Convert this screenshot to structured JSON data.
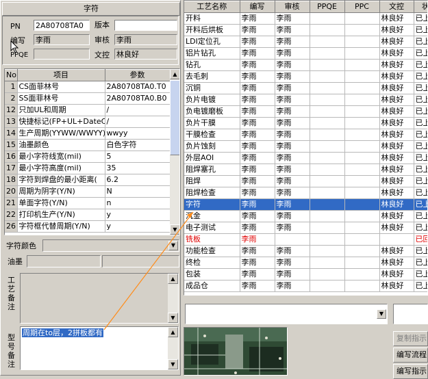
{
  "left": {
    "title": "字符",
    "pn_label": "PN",
    "pn_value": "2A80708TA0",
    "version_label": "版本",
    "version_value": "",
    "author_label": "编写",
    "author_value": "李雨",
    "reviewer_label": "审核",
    "reviewer_value": "李雨",
    "ppqe_label": "PPQE",
    "ppqe_value": "",
    "doc_label": "文控",
    "doc_value": "林良好",
    "params_headers": [
      "No",
      "项目",
      "参数"
    ],
    "params_rows": [
      [
        "1",
        "CS面菲林号",
        "2A80708TA0.T0"
      ],
      [
        "2",
        "SS面菲林号",
        "2A80708TA0.B0"
      ],
      [
        "12",
        "只加UL和周期",
        "/"
      ],
      [
        "13",
        "快捷标记(FP+UL+DateCo",
        "/"
      ],
      [
        "14",
        "生产周期(YYWW/WWYY)",
        "wwyy"
      ],
      [
        "15",
        "油墨颜色",
        "白色字符"
      ],
      [
        "16",
        "最小字符线宽(mil)",
        "5"
      ],
      [
        "17",
        "最小字符高度(mil)",
        "35"
      ],
      [
        "18",
        "字符到焊盘的最小距离(",
        "6.2"
      ],
      [
        "20",
        "周期为阴字(Y/N)",
        "N"
      ],
      [
        "21",
        "单面字符(Y/N)",
        "n"
      ],
      [
        "22",
        "打印机生产(Y/N)",
        "y"
      ],
      [
        "26",
        "字符框代替周期(Y/N)",
        "y"
      ]
    ],
    "char_color_label": "字符颜色",
    "ink_label": "油墨",
    "process_note_label": "工艺备注",
    "model_note_label": "型号备注",
    "model_note_text": "周期在to层，2拼板都有"
  },
  "right": {
    "headers": [
      "工艺名称",
      "编写",
      "审核",
      "PPQE",
      "PPC",
      "文控",
      "状"
    ],
    "rows": [
      [
        "开料",
        "李雨",
        "李雨",
        "",
        "",
        "林良好",
        "已上"
      ],
      [
        "开料后烘板",
        "李雨",
        "李雨",
        "",
        "",
        "林良好",
        "已上"
      ],
      [
        "LDI定位孔",
        "李雨",
        "李雨",
        "",
        "",
        "林良好",
        "已上"
      ],
      [
        "铝片钻孔",
        "李雨",
        "李雨",
        "",
        "",
        "林良好",
        "已上"
      ],
      [
        "钻孔",
        "李雨",
        "李雨",
        "",
        "",
        "林良好",
        "已上"
      ],
      [
        "去毛刺",
        "李雨",
        "李雨",
        "",
        "",
        "林良好",
        "已上"
      ],
      [
        "沉铜",
        "李雨",
        "李雨",
        "",
        "",
        "林良好",
        "已上"
      ],
      [
        "负片电镀",
        "李雨",
        "李雨",
        "",
        "",
        "林良好",
        "已上"
      ],
      [
        "负电镀磨板",
        "李雨",
        "李雨",
        "",
        "",
        "林良好",
        "已上"
      ],
      [
        "负片干膜",
        "李雨",
        "李雨",
        "",
        "",
        "林良好",
        "已上"
      ],
      [
        "干膜检查",
        "李雨",
        "李雨",
        "",
        "",
        "林良好",
        "已上"
      ],
      [
        "负片蚀刻",
        "李雨",
        "李雨",
        "",
        "",
        "林良好",
        "已上"
      ],
      [
        "外层AOI",
        "李雨",
        "李雨",
        "",
        "",
        "林良好",
        "已上"
      ],
      [
        "阻焊塞孔",
        "李雨",
        "李雨",
        "",
        "",
        "林良好",
        "已上"
      ],
      [
        "阻焊",
        "李雨",
        "李雨",
        "",
        "",
        "林良好",
        "已上"
      ],
      [
        "阻焊检查",
        "李雨",
        "李雨",
        "",
        "",
        "林良好",
        "已上"
      ],
      [
        "字符",
        "李雨",
        "李雨",
        "",
        "",
        "林良好",
        "已上"
      ],
      [
        "沉金",
        "李雨",
        "李雨",
        "",
        "",
        "林良好",
        "已上"
      ],
      [
        "电子测试",
        "李雨",
        "李雨",
        "",
        "",
        "林良好",
        "已上"
      ],
      [
        "铣板",
        "李雨",
        "",
        "",
        "",
        "",
        "已回"
      ],
      [
        "功能检查",
        "李雨",
        "李雨",
        "",
        "",
        "林良好",
        "已上"
      ],
      [
        "终检",
        "李雨",
        "李雨",
        "",
        "",
        "林良好",
        "已上"
      ],
      [
        "包装",
        "李雨",
        "李雨",
        "",
        "",
        "林良好",
        "已上"
      ],
      [
        "成品仓",
        "李雨",
        "李雨",
        "",
        "",
        "林良好",
        "已上"
      ]
    ],
    "selected_row": 16,
    "red_row": 19,
    "buttons": [
      "复制指示",
      "编写流程",
      "编写指示"
    ]
  },
  "colors": {
    "selection": "#316ac5",
    "warning_text": "#e00000",
    "arrow": "#ff8c1a"
  }
}
